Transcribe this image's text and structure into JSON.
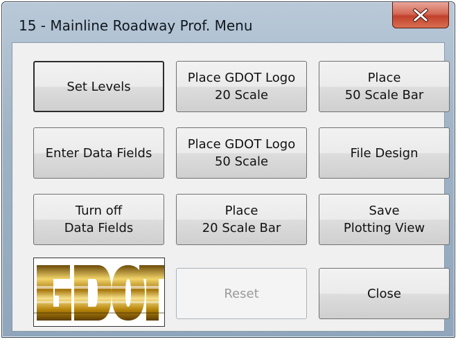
{
  "window": {
    "title": "15 - Mainline Roadway Prof. Menu"
  },
  "buttons": {
    "set_levels": "Set Levels",
    "place_logo_20": "Place GDOT Logo\n20 Scale",
    "place_50_scale_bar": "Place\n50 Scale Bar",
    "enter_data_fields": "Enter Data Fields",
    "place_logo_50": "Place GDOT Logo\n50 Scale",
    "file_design": "File Design",
    "turn_off_data_fields": "Turn off\nData Fields",
    "place_20_scale_bar": "Place\n20 Scale Bar",
    "save_plotting_view": "Save\nPlotting View",
    "reset": "Reset",
    "close": "Close"
  },
  "logo": {
    "text": "GDOT"
  },
  "icons": {
    "close": "close-x-icon"
  },
  "colors": {
    "close_button": "#c2412c",
    "logo_gold": "#b8860b"
  }
}
